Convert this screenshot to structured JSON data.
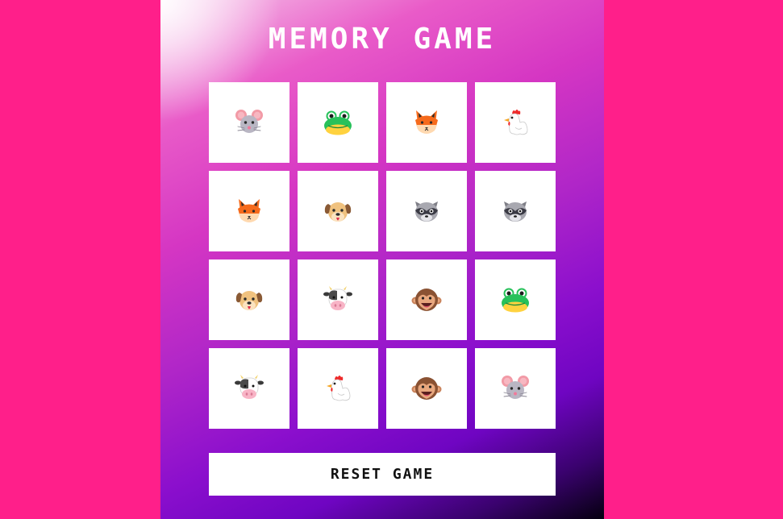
{
  "game": {
    "title": "MEMORY GAME",
    "reset_label": "RESET GAME"
  },
  "colors": {
    "page_background": "#ff1f8a",
    "card_background": "#ffffff",
    "title_text": "#ffffff"
  },
  "cards": [
    {
      "animal": "mouse",
      "icon": "mouse-face-icon"
    },
    {
      "animal": "frog",
      "icon": "frog-face-icon"
    },
    {
      "animal": "fox",
      "icon": "fox-face-icon"
    },
    {
      "animal": "chicken",
      "icon": "chicken-icon"
    },
    {
      "animal": "fox",
      "icon": "fox-face-icon"
    },
    {
      "animal": "dog",
      "icon": "dog-face-icon"
    },
    {
      "animal": "raccoon",
      "icon": "raccoon-face-icon"
    },
    {
      "animal": "raccoon",
      "icon": "raccoon-face-icon"
    },
    {
      "animal": "dog",
      "icon": "dog-face-icon"
    },
    {
      "animal": "cow",
      "icon": "cow-face-icon"
    },
    {
      "animal": "monkey",
      "icon": "monkey-face-icon"
    },
    {
      "animal": "frog",
      "icon": "frog-face-icon"
    },
    {
      "animal": "cow",
      "icon": "cow-face-icon"
    },
    {
      "animal": "chicken",
      "icon": "chicken-icon"
    },
    {
      "animal": "monkey",
      "icon": "monkey-face-icon"
    },
    {
      "animal": "mouse",
      "icon": "mouse-face-icon"
    }
  ]
}
